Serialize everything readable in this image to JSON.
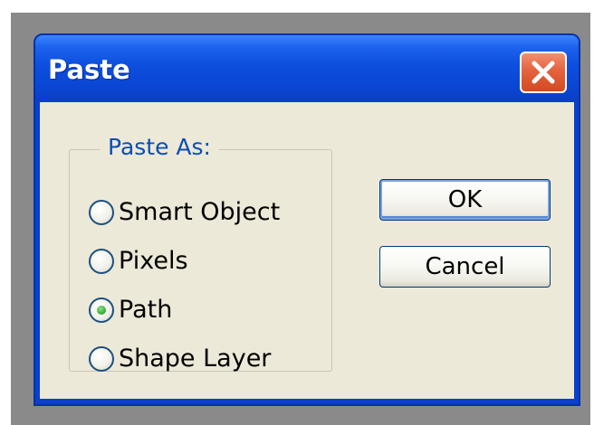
{
  "window": {
    "title": "Paste",
    "close_icon": "close-x-icon",
    "colors": {
      "titlebar": "#0a47d5",
      "client_background": "#ece9d8",
      "close_button": "#e4633e",
      "group_label": "#0b4eb4",
      "radio_selected_dot": "#3bae3a"
    }
  },
  "paste_as": {
    "legend": "Paste As:",
    "options": [
      {
        "label": "Smart Object",
        "selected": false
      },
      {
        "label": "Pixels",
        "selected": false
      },
      {
        "label": "Path",
        "selected": true
      },
      {
        "label": "Shape Layer",
        "selected": false
      }
    ]
  },
  "buttons": {
    "ok_label": "OK",
    "cancel_label": "Cancel"
  }
}
